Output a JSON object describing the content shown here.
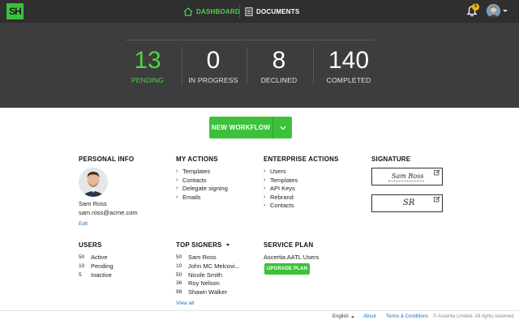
{
  "app": {
    "logo_text": "SH",
    "brand_color": "#3cc23a",
    "accent_color": "#4fd14a"
  },
  "nav": {
    "dashboard_label": "DASHBOARD",
    "documents_label": "DOCUMENTS",
    "notification_count": "5"
  },
  "stats": [
    {
      "value": "13",
      "label": "PENDING"
    },
    {
      "value": "0",
      "label": "IN PROGRESS"
    },
    {
      "value": "8",
      "label": "DECLINED"
    },
    {
      "value": "140",
      "label": "COMPLETED"
    }
  ],
  "new_workflow_label": "NEW WORKFLOW",
  "personal_info": {
    "heading": "PERSONAL INFO",
    "name": "Sam Ross",
    "email": "sam.ross@acme.com",
    "edit_label": "Edit"
  },
  "my_actions": {
    "heading": "MY ACTIONS",
    "items": [
      "Templates",
      "Contacts",
      "Delegate signing",
      "Emails"
    ]
  },
  "enterprise_actions": {
    "heading": "ENTERPRISE ACTIONS",
    "items": [
      "Users",
      "Templates",
      "API Keys",
      "Rebrand",
      "Contacts"
    ]
  },
  "signature": {
    "heading": "SIGNATURE",
    "signature_text": "Sam Ross",
    "initials_text": "SR"
  },
  "users": {
    "heading": "USERS",
    "rows": [
      {
        "count": "50",
        "label": "Active"
      },
      {
        "count": "10",
        "label": "Pending"
      },
      {
        "count": "5",
        "label": "Inactive"
      }
    ]
  },
  "top_signers": {
    "heading": "TOP SIGNERS",
    "rows": [
      {
        "count": "50",
        "name": "Sam Ross"
      },
      {
        "count": "10",
        "name": "John MC Melcovi..."
      },
      {
        "count": "50",
        "name": "Nicole Smith"
      },
      {
        "count": "36",
        "name": "Roy Nelson"
      },
      {
        "count": "98",
        "name": "Shawn Walker"
      }
    ],
    "view_all_label": "View all"
  },
  "service_plan": {
    "heading": "SERVICE PLAN",
    "plan_name": "Ascertia AATL Users",
    "upgrade_label": "UPGRADE PLAN"
  },
  "footer": {
    "language": "English",
    "about": "About",
    "terms": "Terms & Conditions",
    "copyright": "© Ascertia Limited. All rights reserved"
  }
}
